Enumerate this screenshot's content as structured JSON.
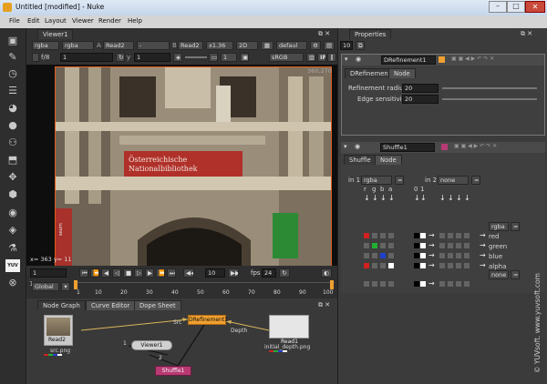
{
  "window": {
    "title": "Untitled [modified] - Nuke"
  },
  "menu": [
    "File",
    "Edit",
    "Layout",
    "Viewer",
    "Render",
    "Help"
  ],
  "viewer": {
    "tab": "Viewer1",
    "channels": "rgba",
    "layer": "rgba",
    "read_a": "Read2",
    "dash": "-",
    "b_label": "B",
    "read_b": "Read2",
    "zoom": "x1.36",
    "mode": "2D",
    "lut": "defaul",
    "fstop": "f/8",
    "exposure": "1",
    "y_label": "y",
    "gamma": "1",
    "frame_field": "1",
    "srgb": "sRGB",
    "resolution": "360,270",
    "res_badge": "360x270",
    "coords": "x= 363 y=  11",
    "sign_line1": "Österreichische",
    "sign_line2": "Nationalbibliothek",
    "banner_text": "seum"
  },
  "timeline": {
    "frame": "1",
    "fps_label": "fps",
    "fps": "24",
    "step": "10",
    "range_start": "1",
    "scope": "Global",
    "ticks": [
      "1",
      "10",
      "20",
      "30",
      "40",
      "50",
      "60",
      "70",
      "80",
      "90",
      "100"
    ],
    "end": "100"
  },
  "nodegraph": {
    "tabs": [
      "Node Graph",
      "Curve Editor",
      "Dope Sheet"
    ],
    "nodes": {
      "read2": "Read2",
      "read2_file": "src.png",
      "read1": "Read1",
      "read1_file": "initial_depth.png",
      "viewer1": "Viewer1",
      "drefinement": "DRefinement1",
      "shuffle": "Shuffle1"
    },
    "edges": {
      "src": "Src",
      "depth": "Depth",
      "input1": "1",
      "input2": "2"
    }
  },
  "properties": {
    "title": "Properties",
    "count": "10",
    "drefinement": {
      "name": "DRefinement1",
      "tabs": [
        "DRefinement",
        "Node"
      ],
      "params": [
        {
          "label": "Refinement radius",
          "value": "20"
        },
        {
          "label": "Edge sensitivity",
          "value": "20"
        }
      ]
    },
    "shuffle": {
      "name": "Shuffle1",
      "tabs": [
        "Shuffle",
        "Node"
      ],
      "in1_label": "in 1",
      "in1": "rgba",
      "in2_label": "in 2",
      "in2": "none",
      "col_labels": [
        "r",
        "g",
        "b",
        "a"
      ],
      "col_labels2": [
        "0",
        "1"
      ],
      "out1": "rgba",
      "out2": "none",
      "rows": [
        "red",
        "green",
        "blue",
        "alpha"
      ]
    }
  },
  "watermark": "© YUVsoft. www.yuvsoft.com",
  "colors": {
    "node_orange": "#f0a030",
    "shuffle_pink": "#b83a73",
    "viewer_frame": "#e05c1c",
    "red": "#d02020",
    "green": "#20b030",
    "blue": "#2040d0"
  }
}
